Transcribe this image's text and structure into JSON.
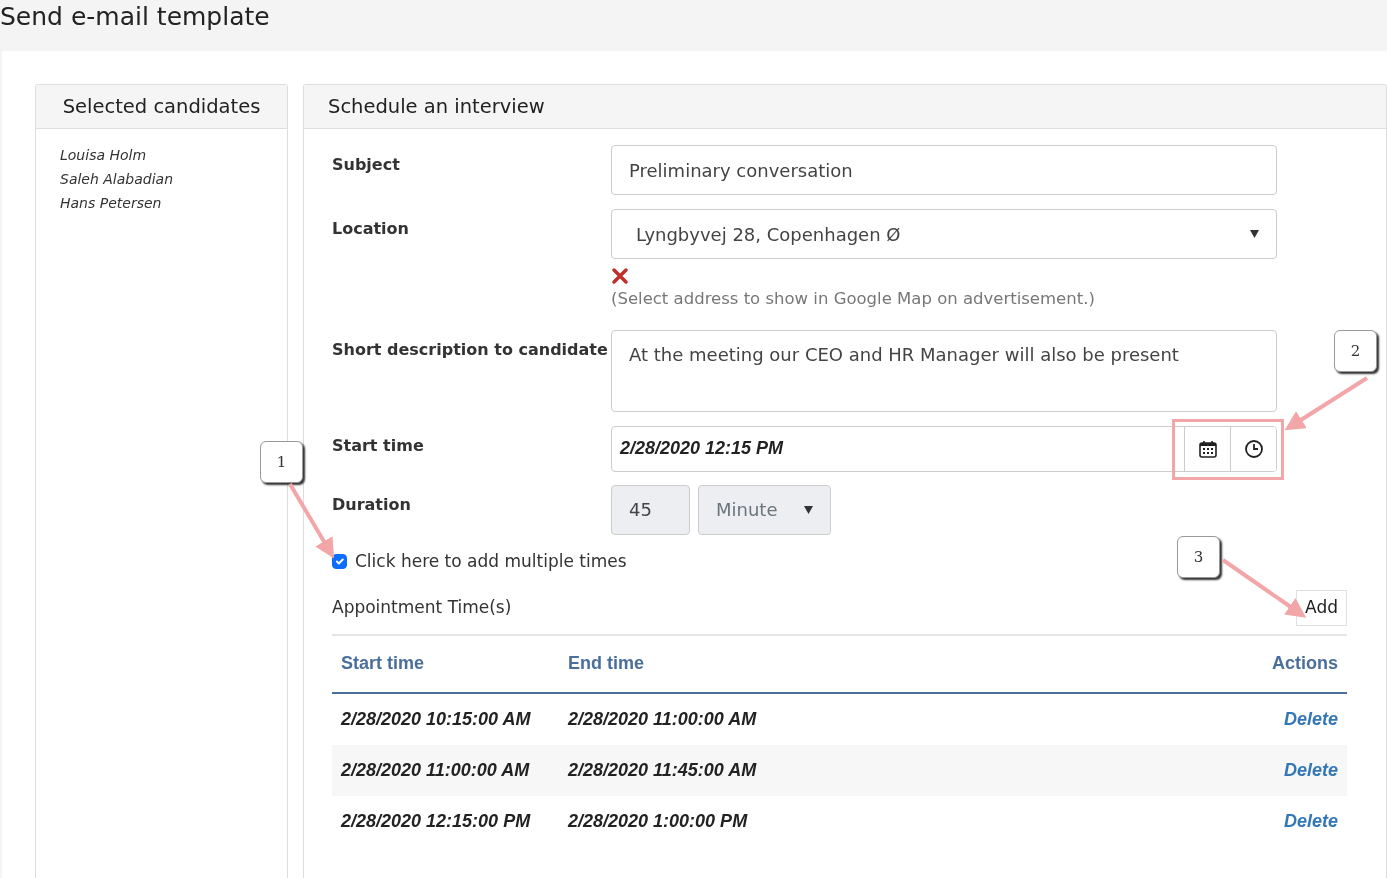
{
  "page_title": "Send e-mail template",
  "candidates": {
    "title": "Selected candidates",
    "names": [
      "Louisa Holm",
      "Saleh Alabadian",
      "Hans Petersen"
    ]
  },
  "schedule": {
    "title": "Schedule an interview",
    "subject": {
      "label": "Subject",
      "value": "Preliminary conversation"
    },
    "location": {
      "label": "Location",
      "value": "Lyngbyvej 28, Copenhagen Ø",
      "hint": "(Select address to show in Google Map on advertisement.)"
    },
    "description": {
      "label": "Short description to candidate",
      "value": "At the meeting our CEO and HR Manager will also be present"
    },
    "start_time": {
      "label": "Start time",
      "value": "2/28/2020 12:15 PM"
    },
    "duration": {
      "label": "Duration",
      "amount": "45",
      "unit": "Minute",
      "disabled": true
    },
    "multiple_times": {
      "label": "Click here to add multiple times",
      "checked": true
    },
    "appointments": {
      "title": "Appointment Time(s)",
      "add_button": "Add",
      "columns": [
        "Start time",
        "End time",
        "Actions"
      ],
      "rows": [
        {
          "start": "2/28/2020 10:15:00 AM",
          "end": "2/28/2020 11:00:00 AM",
          "action": "Delete"
        },
        {
          "start": "2/28/2020 11:00:00 AM",
          "end": "2/28/2020 11:45:00 AM",
          "action": "Delete"
        },
        {
          "start": "2/28/2020 12:15:00 PM",
          "end": "2/28/2020 1:00:00 PM",
          "action": "Delete"
        }
      ]
    }
  },
  "callouts": [
    "1",
    "2",
    "3"
  ]
}
